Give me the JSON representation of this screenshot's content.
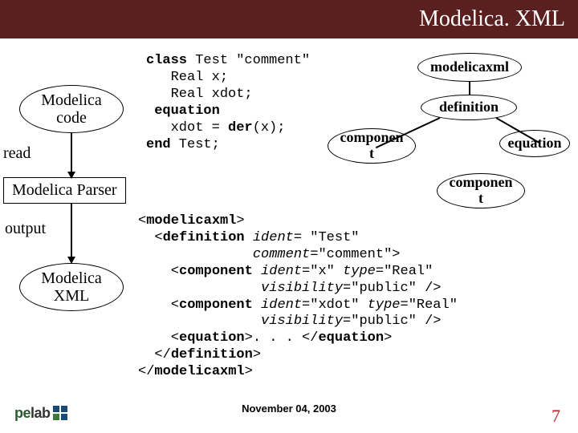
{
  "title": "Modelica. XML",
  "pipeline": {
    "modelica_code": "Modelica\ncode",
    "modelica_xml": "Modelica\nXML",
    "parser": "Modelica Parser",
    "read": "read",
    "output": "output"
  },
  "tree": {
    "root": "modelicaxml",
    "definition": "definition",
    "component_upper": "componen\nt",
    "equation": "equation",
    "component_lower": "componen\nt"
  },
  "code_top": {
    "l1a": "class",
    "l1b": " Test \"comment\"",
    "l2": "   Real x;",
    "l3": "   Real xdot;",
    "l4": " equation",
    "l5a": "   xdot = ",
    "l5b": "der",
    "l5c": "(x);",
    "l6a": "end",
    "l6b": " Test;"
  },
  "code_bottom": {
    "l1a": "<",
    "l1b": "modelicaxml",
    "l1c": ">",
    "l2a": "  <",
    "l2b": "definition",
    "l2c": " ",
    "l2d": "ident=",
    "l2e": " \"Test\"",
    "l3a": "              ",
    "l3b": "comment=",
    "l3c": "\"comment\">",
    "l4a": "    <",
    "l4b": "component",
    "l4c": " ",
    "l4d": "ident=",
    "l4e": "\"x\" ",
    "l4f": "type=",
    "l4g": "\"Real\"",
    "l5a": "               ",
    "l5b": "visibility=",
    "l5c": "\"public\" />",
    "l6a": "    <",
    "l6b": "component",
    "l6c": " ",
    "l6d": "ident=",
    "l6e": "\"xdot\" ",
    "l6f": "type=",
    "l6g": "\"Real\"",
    "l7a": "               ",
    "l7b": "visibility=",
    "l7c": "\"public\" />",
    "l8a": "    <",
    "l8b": "equation",
    "l8c": ">. . . </",
    "l8d": "equation",
    "l8e": ">",
    "l9a": "  </",
    "l9b": "definition",
    "l9c": ">",
    "l10a": "</",
    "l10b": "modelicaxml",
    "l10c": ">"
  },
  "footer": {
    "date": "November 04, 2003",
    "page": "7",
    "logo_pe": "pe",
    "logo_lab": "lab"
  }
}
